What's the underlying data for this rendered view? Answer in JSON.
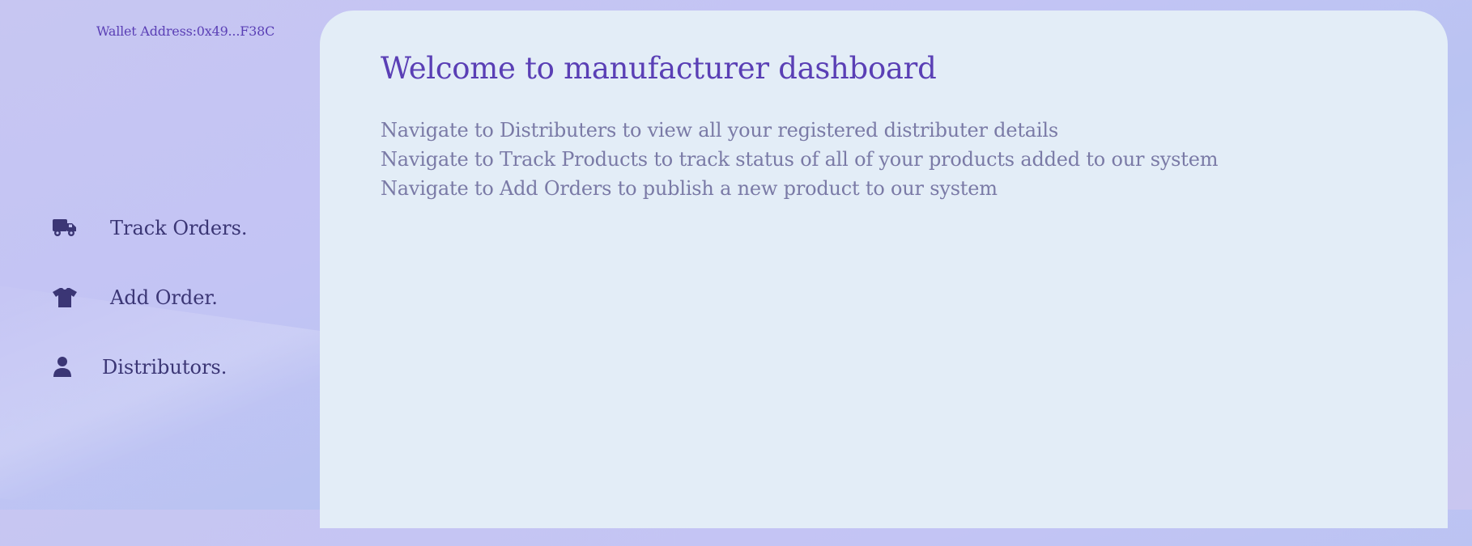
{
  "wallet": {
    "text": "Wallet Address:0x49...F38C"
  },
  "sidebar": {
    "items": [
      {
        "label": "Track Orders.",
        "icon": "truck-icon"
      },
      {
        "label": "Add Order.",
        "icon": "tshirt-icon"
      },
      {
        "label": "Distributors.",
        "icon": "user-icon"
      }
    ]
  },
  "main": {
    "title": "Welcome to manufacturer dashboard",
    "lines": [
      "Navigate to Distributers to view all your registered distributer details",
      "Navigate to Track Products to track status of all of your products added to our system",
      "Navigate to Add Orders to publish a new product to our system"
    ]
  },
  "colors": {
    "accent": "#5a3fb5",
    "nav_text": "#3b3675",
    "panel_bg": "#e3edf7",
    "muted_text": "#7a7aa6"
  }
}
